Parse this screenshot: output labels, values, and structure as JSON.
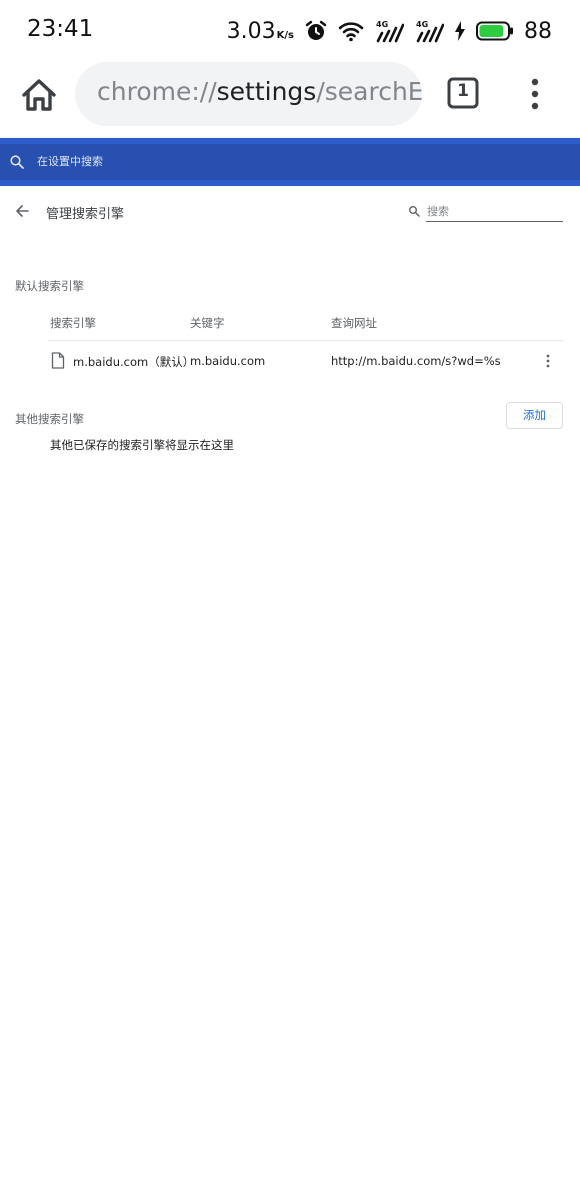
{
  "status_bar": {
    "time": "23:41",
    "net_speed": "3.03",
    "net_speed_unit": "K/s",
    "battery_level": "88",
    "battery_fraction": 0.88,
    "battery_color": "#2ecc40",
    "icons": [
      "alarm-icon",
      "wifi-icon",
      "signal-4g-icon",
      "signal-4g-icon",
      "charging-icon",
      "battery-icon"
    ]
  },
  "browser": {
    "url_scheme": "chrome://",
    "url_host": "settings",
    "url_path": "/searchEngines",
    "tab_count": "1"
  },
  "settings_search": {
    "placeholder": "在设置中搜索",
    "bar_color": "#2b5cc8"
  },
  "page": {
    "title": "管理搜索引擎",
    "search_placeholder": "搜索"
  },
  "default_section": {
    "title": "默认搜索引擎",
    "columns": [
      "搜索引擎",
      "关键字",
      "查询网址"
    ],
    "rows": [
      {
        "name": "m.baidu.com（默认）",
        "keyword": "m.baidu.com",
        "url": "http://m.baidu.com/s?wd=%s"
      }
    ]
  },
  "other_section": {
    "title": "其他搜索引擎",
    "add_label": "添加",
    "empty_message": "其他已保存的搜索引擎将显示在这里"
  },
  "colors": {
    "accent": "#1a73e8"
  }
}
